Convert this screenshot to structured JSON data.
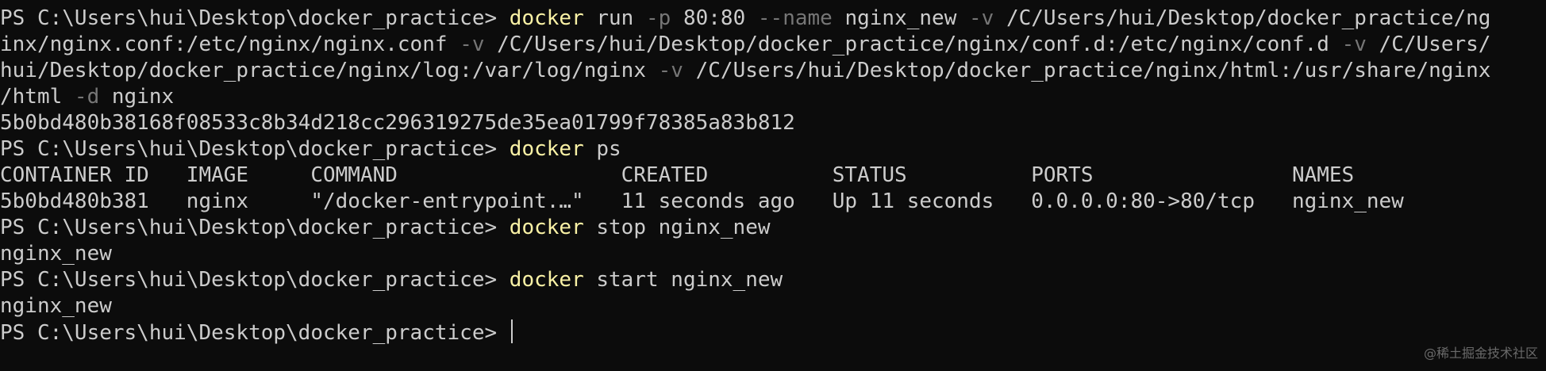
{
  "terminal": {
    "prompt": "PS C:\\Users\\hui\\Desktop\\docker_practice> ",
    "run_cmd": {
      "cmd": "docker",
      "s1": " run ",
      "f1": "-p",
      "s2": " 80:80 ",
      "f2": "--name",
      "s3": " nginx_new ",
      "f3": "-v",
      "s4": " /C/Users/hui/Desktop/docker_practice/ng",
      "l2_a": "inx/nginx.conf:/etc/nginx/nginx.conf ",
      "f4": "-v",
      "l2_b": " /C/Users/hui/Desktop/docker_practice/nginx/conf.d:/etc/nginx/conf.d ",
      "f5": "-v",
      "l2_c": " /C/Users/",
      "l3_a": "hui/Desktop/docker_practice/nginx/log:/var/log/nginx ",
      "f6": "-v",
      "l3_b": " /C/Users/hui/Desktop/docker_practice/nginx/html:/usr/share/nginx",
      "l4_a": "/html ",
      "f7": "-d",
      "l4_b": " nginx"
    },
    "container_hash": "5b0bd480b38168f08533c8b34d218cc296319275de35ea01799f78385a83b812",
    "ps_cmd": {
      "cmd": "docker",
      "args": " ps"
    },
    "ps_header": "CONTAINER ID   IMAGE     COMMAND                  CREATED          STATUS          PORTS                NAMES",
    "ps_row": "5b0bd480b381   nginx     \"/docker-entrypoint.…\"   11 seconds ago   Up 11 seconds   0.0.0.0:80->80/tcp   nginx_new",
    "stop_cmd": {
      "cmd": "docker",
      "args": " stop nginx_new"
    },
    "stop_output": "nginx_new",
    "start_cmd": {
      "cmd": "docker",
      "args": " start nginx_new"
    },
    "start_output": "nginx_new"
  },
  "watermark": "@稀土掘金技术社区",
  "colors": {
    "background": "#0c0c0c",
    "text": "#cccccc",
    "command": "#f9f1a5",
    "flag": "#767676"
  }
}
